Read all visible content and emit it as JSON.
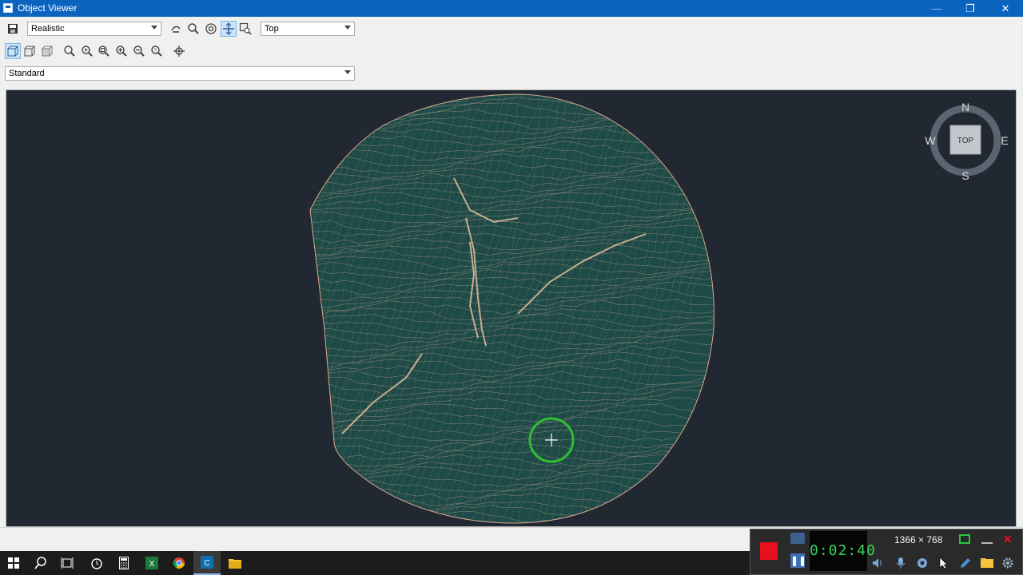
{
  "window": {
    "title": "Object Viewer",
    "min_glyph": "—",
    "max_glyph": "❐",
    "close_glyph": "✕"
  },
  "toolbar": {
    "visual_style": {
      "selected": "Realistic"
    },
    "view": {
      "selected": "Top"
    },
    "visual_style_set": {
      "selected": "Standard"
    },
    "icons_row1": [
      "save-icon",
      "orbit-icon",
      "zoom-icon",
      "zoom-extents-icon",
      "pan-icon",
      "zoom-window-icon"
    ],
    "icons_row2": [
      "wireframe-cube-icon",
      "shaded-cube-icon",
      "conceptual-cube-icon",
      "zoom-realtime-icon",
      "zoom-in-icon",
      "zoom-all-icon",
      "zoom-in-plus-icon",
      "zoom-out-icon",
      "zoom-previous-icon",
      "center-icon"
    ]
  },
  "viewcube": {
    "north": "N",
    "south": "S",
    "east": "E",
    "west": "W",
    "face": "TOP"
  },
  "recorder": {
    "timer": "0:02:40",
    "resolution": "1366 × 768"
  },
  "taskbar": {
    "items": [
      "windows-start-icon",
      "search-icon",
      "task-view-icon",
      "alarm-icon",
      "calculator-icon",
      "excel-icon",
      "chrome-icon",
      "civil3d-icon",
      "file-explorer-icon"
    ]
  },
  "colors": {
    "titlebar": "#0b63c0",
    "viewport_bg": "#212832",
    "terrain_fill": "#1e4a48",
    "terrain_lines": "#e5b89a",
    "cursor_ring": "#2fbf2f",
    "record": "#e8101e",
    "timer_text": "#36d45b"
  }
}
